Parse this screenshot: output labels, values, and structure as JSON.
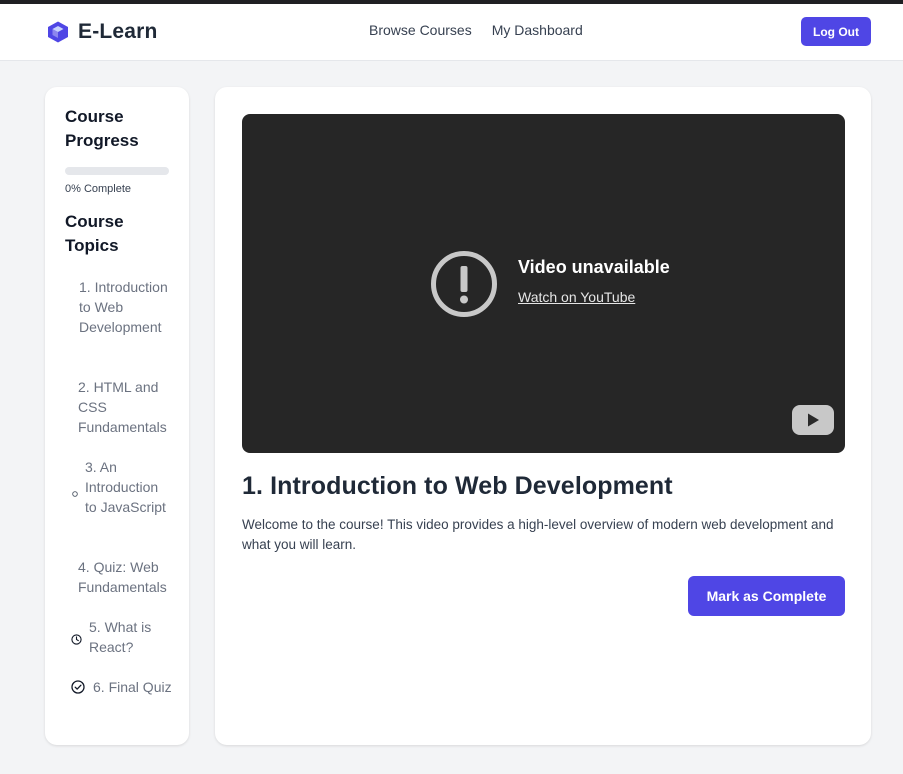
{
  "app": {
    "brand_name": "E-Learn",
    "brand_color": "#4f46e5"
  },
  "nav": {
    "links": [
      "Browse Courses",
      "My Dashboard"
    ],
    "logout_label": "Log Out"
  },
  "sidebar": {
    "progress_heading": "Course Progress",
    "progress_fraction": 0,
    "progress_label": "0% Complete",
    "topics_heading": "Course Topics",
    "topics": [
      {
        "label": "1. Introduction to Web Development",
        "icon": "none"
      },
      {
        "label": "2. HTML and CSS Fundamentals",
        "icon": "none"
      },
      {
        "label": "3. An Introduction to JavaScript",
        "icon": "small-circle-icon"
      },
      {
        "label": "4. Quiz: Web Fundamentals",
        "icon": "none"
      },
      {
        "label": "5. What is React?",
        "icon": "clock-icon"
      },
      {
        "label": "6. Final Quiz",
        "icon": "check-circle-icon"
      }
    ]
  },
  "video": {
    "title": "Video unavailable",
    "link_text": "Watch on YouTube",
    "alert_icon": "exclamation-circle-icon",
    "player_icon": "youtube-icon"
  },
  "lesson": {
    "title": "1. Introduction to Web Development",
    "description": "Welcome to the course! This video provides a high-level overview of modern web development and what you will learn.",
    "complete_button": "Mark as Complete"
  }
}
